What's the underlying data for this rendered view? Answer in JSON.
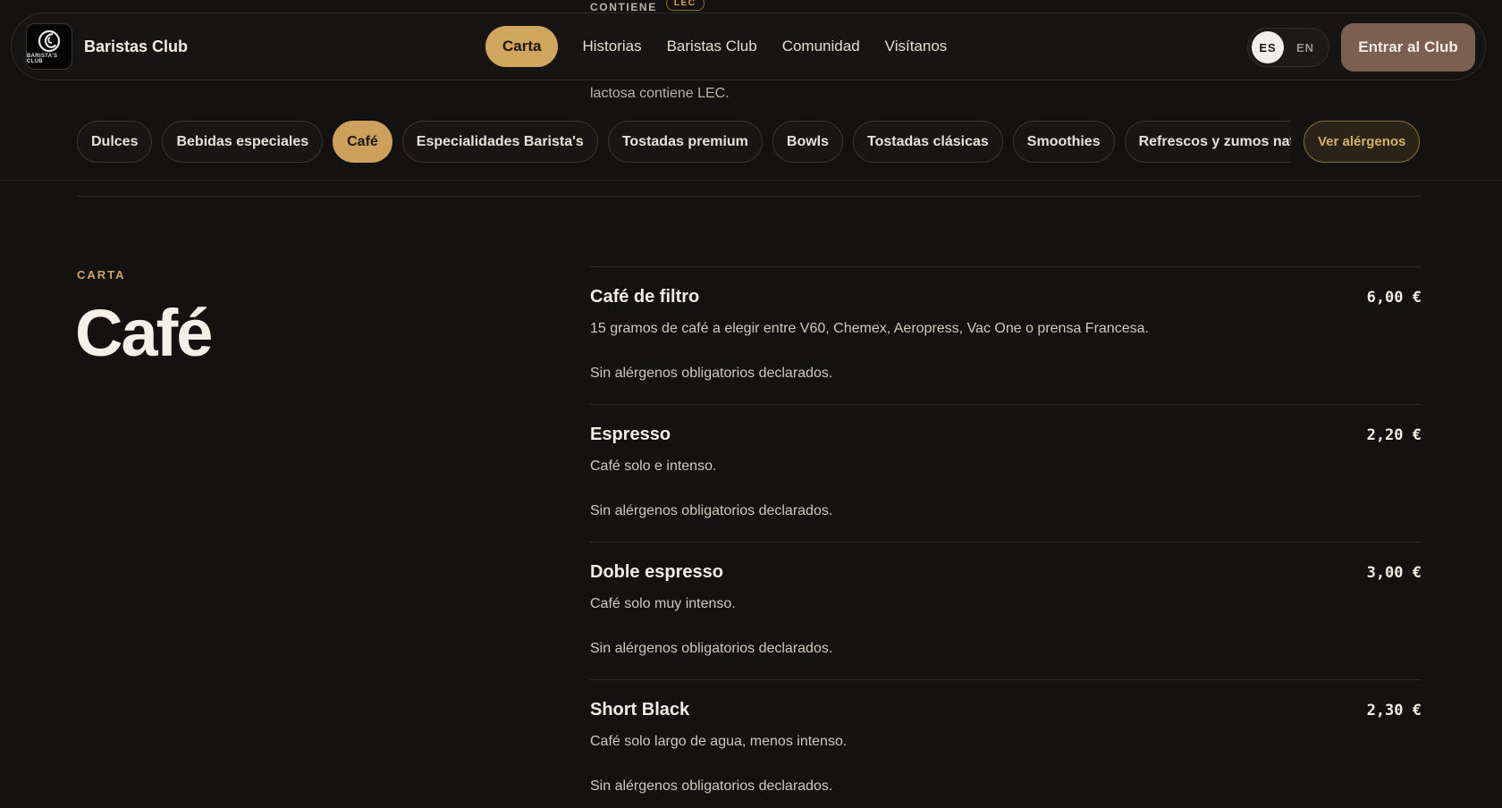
{
  "peek": {
    "label": "CONTIENE",
    "tag": "LEC",
    "line": "lactosa contiene LEC."
  },
  "header": {
    "brand_name": "Baristas Club",
    "logo_text": "BARISTA'S CLUB",
    "nav": [
      {
        "label": "Carta",
        "active": true
      },
      {
        "label": "Historias"
      },
      {
        "label": "Baristas Club"
      },
      {
        "label": "Comunidad"
      },
      {
        "label": "Visítanos"
      }
    ],
    "lang": {
      "active": "ES",
      "other": "EN"
    },
    "cta": "Entrar al Club"
  },
  "categories": [
    {
      "label": "Dulces"
    },
    {
      "label": "Bebidas especiales"
    },
    {
      "label": "Café",
      "active": true
    },
    {
      "label": "Especialidades Barista's"
    },
    {
      "label": "Tostadas premium"
    },
    {
      "label": "Bowls"
    },
    {
      "label": "Tostadas clásicas"
    },
    {
      "label": "Smoothies"
    },
    {
      "label": "Refrescos y zumos naturales"
    }
  ],
  "allergens_button": "Ver alérgenos",
  "section": {
    "kicker": "CARTA",
    "title": "Café"
  },
  "items": [
    {
      "name": "Café de filtro",
      "price": "6,00 €",
      "desc": "15 gramos de café a elegir entre V60, Chemex, Aeropress, Vac One o prensa Francesa.",
      "allergens": "Sin alérgenos obligatorios declarados."
    },
    {
      "name": "Espresso",
      "price": "2,20 €",
      "desc": "Café solo e intenso.",
      "allergens": "Sin alérgenos obligatorios declarados."
    },
    {
      "name": "Doble espresso",
      "price": "3,00 €",
      "desc": "Café solo muy intenso.",
      "allergens": "Sin alérgenos obligatorios declarados."
    },
    {
      "name": "Short Black",
      "price": "2,30 €",
      "desc": "Café solo largo de agua, menos intenso.",
      "allergens": "Sin alérgenos obligatorios declarados."
    }
  ],
  "colors": {
    "background": "#141210",
    "accent_gold": "#cda15b",
    "cta_brown": "#7b6052",
    "text": "#f2ece3"
  }
}
